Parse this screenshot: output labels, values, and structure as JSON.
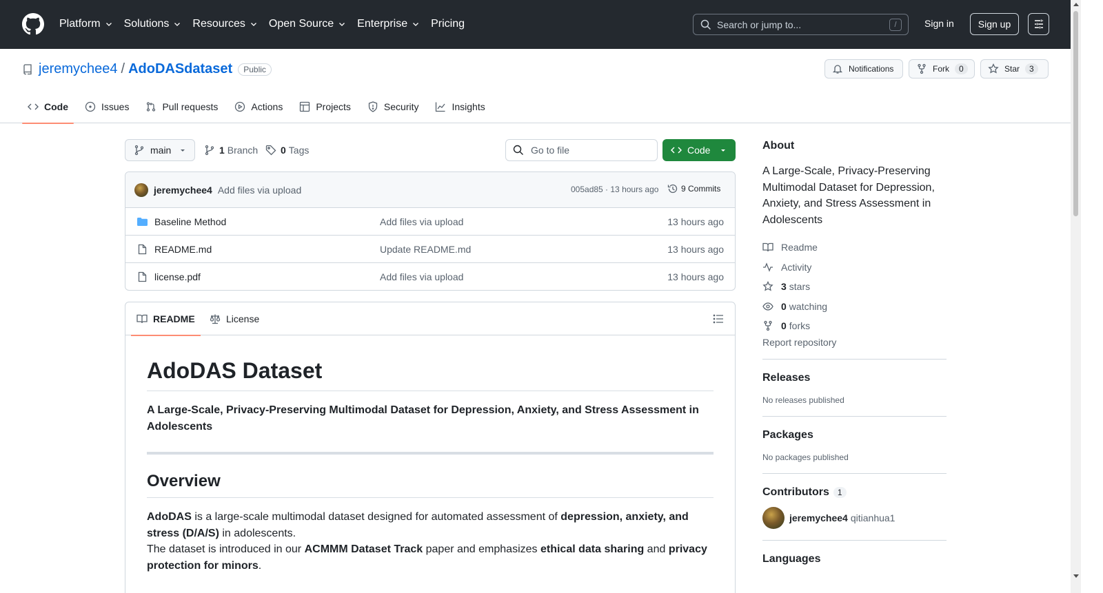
{
  "header": {
    "nav": [
      {
        "label": "Platform",
        "has_menu": true
      },
      {
        "label": "Solutions",
        "has_menu": true
      },
      {
        "label": "Resources",
        "has_menu": true
      },
      {
        "label": "Open Source",
        "has_menu": true
      },
      {
        "label": "Enterprise",
        "has_menu": true
      },
      {
        "label": "Pricing",
        "has_menu": false
      }
    ],
    "search_placeholder": "Search or jump to...",
    "search_shortcut": "/",
    "sign_in": "Sign in",
    "sign_up": "Sign up"
  },
  "repo": {
    "owner": "jeremychee4",
    "separator": "/",
    "name": "AdoDASdataset",
    "visibility": "Public",
    "actions": {
      "notifications": "Notifications",
      "fork": "Fork",
      "fork_count": "0",
      "star": "Star",
      "star_count": "3"
    },
    "tabs": [
      "Code",
      "Issues",
      "Pull requests",
      "Actions",
      "Projects",
      "Security",
      "Insights"
    ],
    "selected_tab": "Code"
  },
  "toolbar": {
    "branch": "main",
    "branch_count": "1",
    "branch_label": "Branch",
    "tag_count": "0",
    "tag_label": "Tags",
    "goto_placeholder": "Go to file",
    "code_button": "Code"
  },
  "commit": {
    "author": "jeremychee4",
    "message": "Add files via upload",
    "sha_time": "005ad85 · 13 hours ago",
    "commits_label": "9 Commits"
  },
  "files": [
    {
      "type": "folder",
      "name": "Baseline Method",
      "message": "Add files via upload",
      "time": "13 hours ago"
    },
    {
      "type": "file",
      "name": "README.md",
      "message": "Update README.md",
      "time": "13 hours ago"
    },
    {
      "type": "file",
      "name": "license.pdf",
      "message": "Add files via upload",
      "time": "13 hours ago"
    }
  ],
  "readme": {
    "tabs": [
      "README",
      "License"
    ],
    "h1": "AdoDAS Dataset",
    "subtitle": "A Large-Scale, Privacy-Preserving Multimodal Dataset for Depression, Anxiety, and Stress Assessment in Adolescents",
    "h2": "Overview",
    "p1": {
      "b1": "AdoDAS",
      "t1": " is a large-scale multimodal dataset designed for automated assessment of ",
      "b2": "depression, anxiety, and stress (D/A/S)",
      "t2": " in adolescents."
    },
    "p2": {
      "t1": "The dataset is introduced in our ",
      "b1": "ACMMM Dataset Track",
      "t2": " paper and emphasizes ",
      "b2": "ethical data sharing",
      "t3": " and ",
      "b3": "privacy protection for minors",
      "t4": "."
    }
  },
  "sidebar": {
    "about_title": "About",
    "about_desc": "A Large-Scale, Privacy-Preserving Multimodal Dataset for Depression, Anxiety, and Stress Assessment in Adolescents",
    "links": {
      "readme": "Readme",
      "activity": "Activity",
      "stars_count": "3",
      "stars_label": "stars",
      "watching_count": "0",
      "watching_label": "watching",
      "forks_count": "0",
      "forks_label": "forks"
    },
    "report": "Report repository",
    "releases_title": "Releases",
    "releases_empty": "No releases published",
    "packages_title": "Packages",
    "packages_empty": "No packages published",
    "contributors_title": "Contributors",
    "contributors_count": "1",
    "contributor_name": "jeremychee4",
    "contributor_alias": "qitianhua1",
    "languages_title": "Languages"
  },
  "colors": {
    "header_bg": "#24292f",
    "link": "#0969da",
    "primary_button": "#1f883d",
    "tab_underline": "#fd8c73"
  }
}
